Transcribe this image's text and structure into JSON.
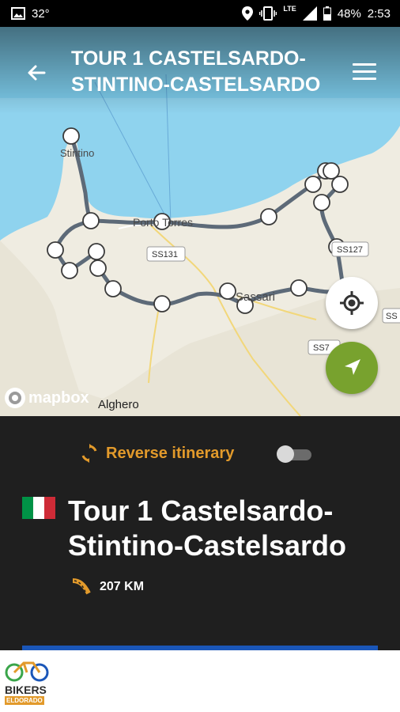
{
  "status_bar": {
    "temperature": "32°",
    "network": "LTE",
    "battery": "48%",
    "time": "2:53",
    "icons": [
      "image-icon",
      "location-icon",
      "vibrate-icon",
      "signal-icon",
      "battery-icon"
    ]
  },
  "header": {
    "title": "TOUR 1 CASTELSARDO-STINTINO-CASTELSARDO",
    "back_icon": "arrow-left-icon",
    "menu_icon": "hamburger-menu-icon"
  },
  "map": {
    "place_labels": [
      "Stintino",
      "Porto Torres",
      "Sassari",
      "Alghero"
    ],
    "road_labels": [
      "SS131",
      "SS127",
      "SS7",
      "SS"
    ],
    "attribution": "mapbox",
    "locate_icon": "crosshair-icon",
    "navigate_icon": "navigation-arrow-icon"
  },
  "itinerary": {
    "reverse_label": "Reverse itinerary",
    "reverse_enabled": false,
    "reverse_icon": "sync-icon",
    "flag_icon": "italy-flag-icon",
    "flag_colors": [
      "#009246",
      "#ffffff",
      "#ce2b37"
    ],
    "tour_name": "Tour 1 Castelsardo-Stintino-Castelsardo",
    "distance": "207 KM",
    "distance_icon": "road-icon"
  },
  "footer": {
    "brand_top": "BIKERS",
    "brand_bottom": "ELDORADO"
  },
  "colors": {
    "accent": "#e29a2b",
    "panel_bg": "#1f1f1f",
    "nav_button": "#78a22e",
    "route": "#5d6a78",
    "progress": "#1a56b8"
  }
}
